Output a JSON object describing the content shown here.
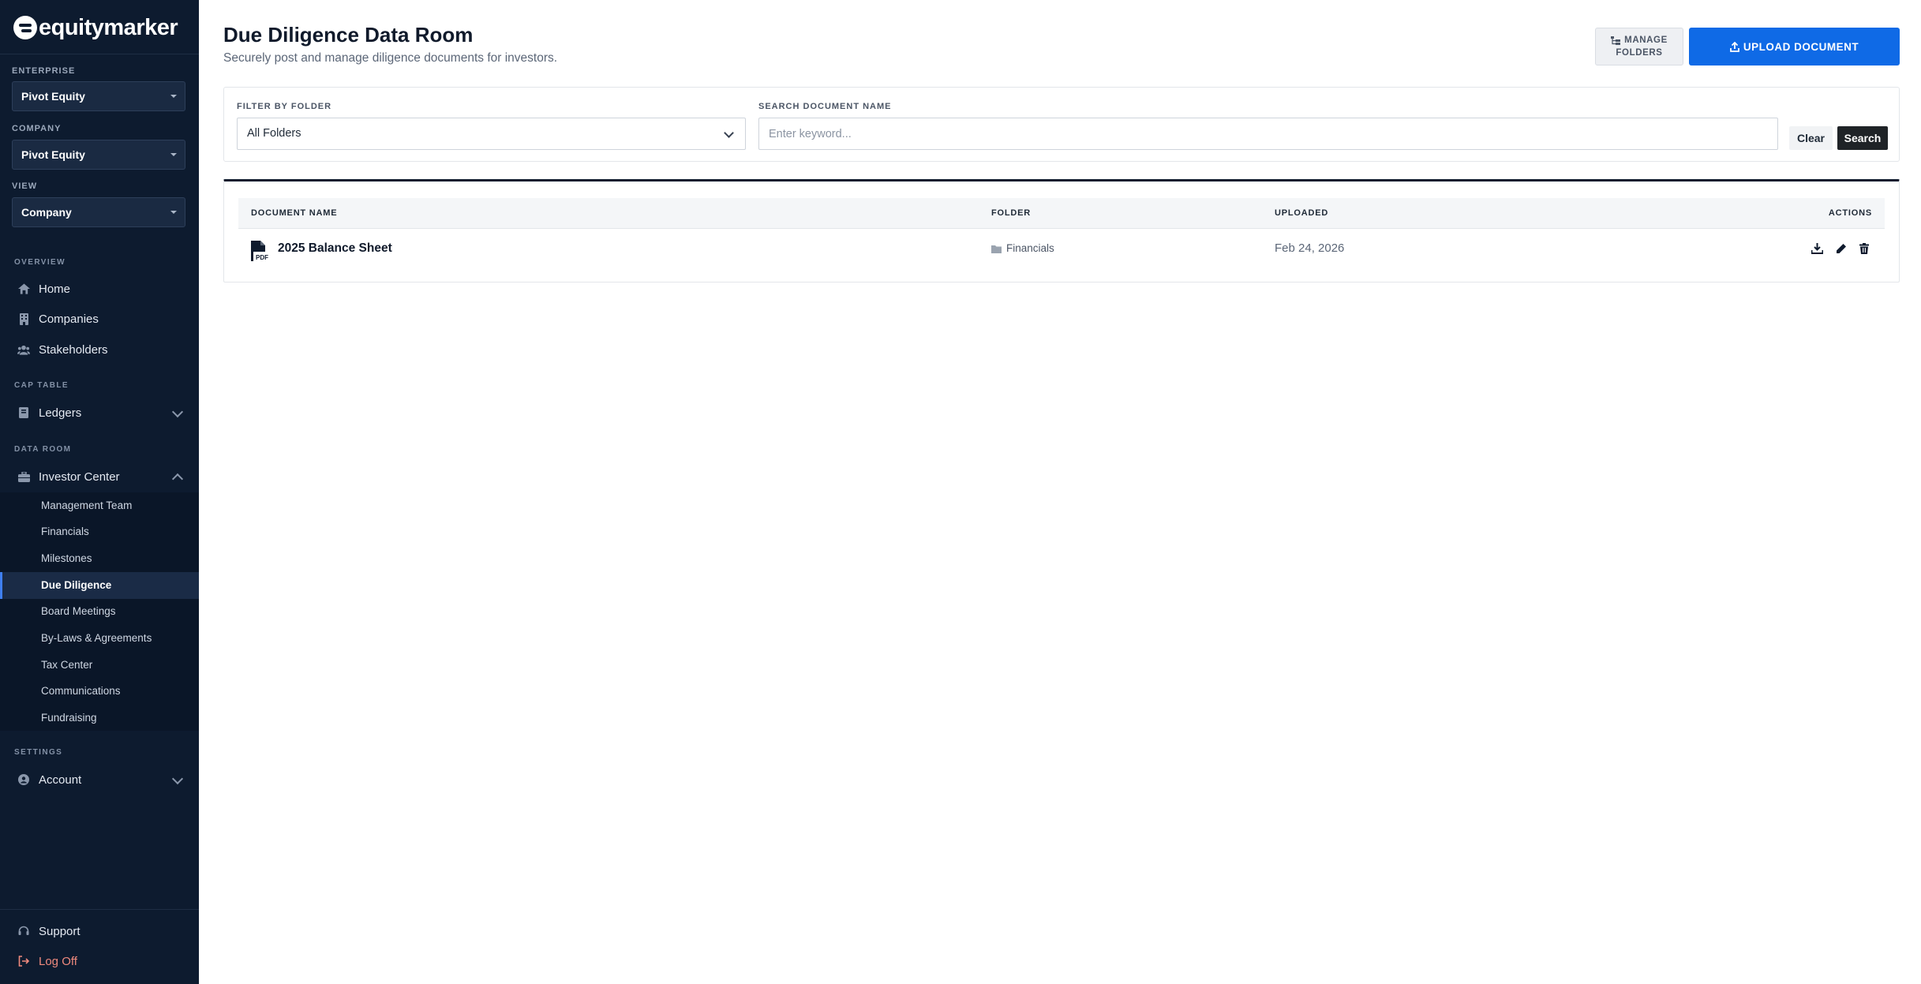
{
  "brand": {
    "name": "equitymarker"
  },
  "sidebar": {
    "selectors": [
      {
        "label": "ENTERPRISE",
        "value": "Pivot Equity"
      },
      {
        "label": "COMPANY",
        "value": "Pivot Equity"
      },
      {
        "label": "VIEW",
        "value": "Company"
      }
    ],
    "sections": {
      "overview": "OVERVIEW",
      "cap_table": "CAP TABLE",
      "data_room": "DATA ROOM",
      "settings": "SETTINGS"
    },
    "nav": {
      "home": "Home",
      "companies": "Companies",
      "stakeholders": "Stakeholders",
      "ledgers": "Ledgers",
      "investor_center": "Investor Center",
      "account": "Account",
      "support": "Support",
      "logoff": "Log Off"
    },
    "sub_items": [
      "Management Team",
      "Financials",
      "Milestones",
      "Due Diligence",
      "Board Meetings",
      "By-Laws & Agreements",
      "Tax Center",
      "Communications",
      "Fundraising"
    ],
    "active_sub": "Due Diligence"
  },
  "page": {
    "title": "Due Diligence Data Room",
    "subtitle": "Securely post and manage diligence documents for investors.",
    "manage_folders_line1": "MANAGE",
    "manage_folders_line2": "FOLDERS",
    "upload_label": "UPLOAD DOCUMENT"
  },
  "filters": {
    "folder_label": "FILTER BY FOLDER",
    "folder_value": "All Folders",
    "search_label": "SEARCH DOCUMENT NAME",
    "search_placeholder": "Enter keyword...",
    "search_value": "",
    "clear_label": "Clear",
    "search_button": "Search"
  },
  "table": {
    "headers": {
      "name": "DOCUMENT NAME",
      "folder": "FOLDER",
      "uploaded": "UPLOADED",
      "actions": "ACTIONS"
    },
    "rows": [
      {
        "name": "2025 Balance Sheet",
        "folder": "Financials",
        "uploaded": "Feb 24, 2026",
        "file_type_badge": "PDF"
      }
    ]
  },
  "colors": {
    "sidebar_bg": "#0d1b2f",
    "accent": "#0f6ae6",
    "logoff": "#f08a7e"
  }
}
